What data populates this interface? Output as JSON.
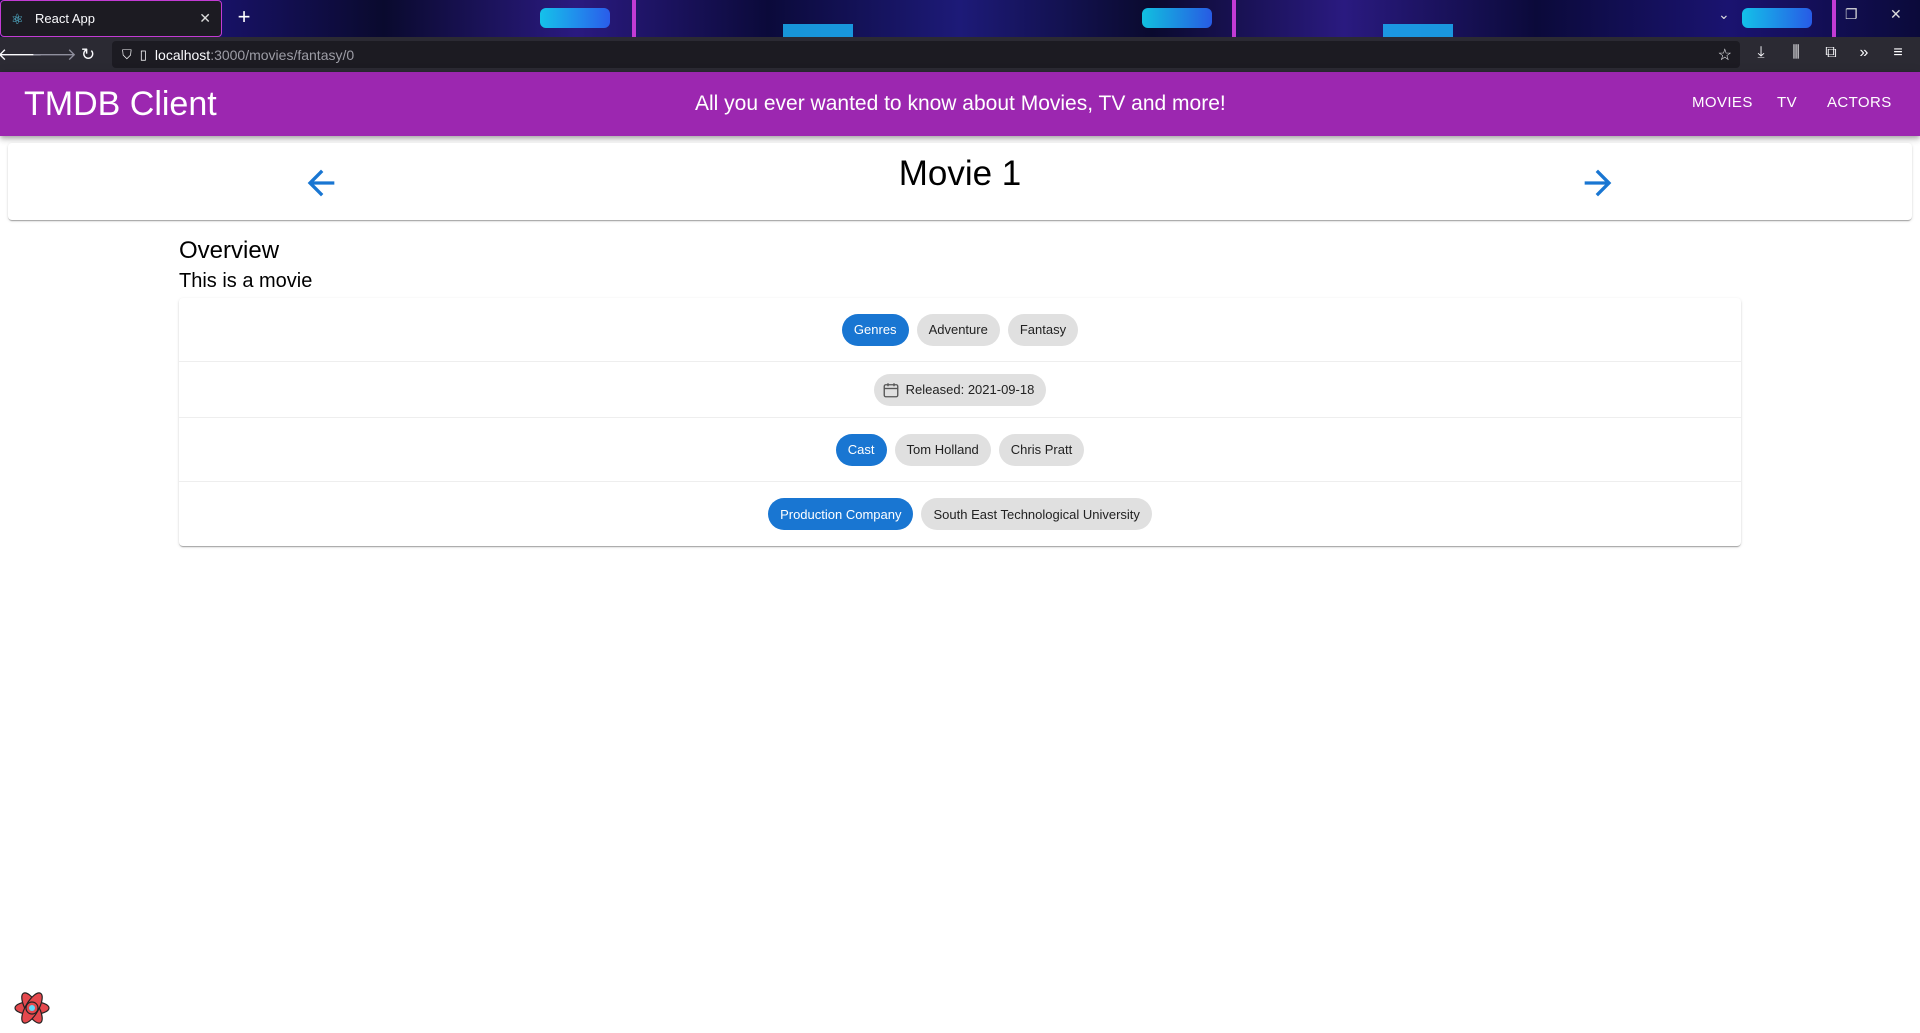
{
  "browser": {
    "tab_title": "React App",
    "url_host": "localhost",
    "url_path": ":3000/movies/fantasy/0"
  },
  "app": {
    "title": "TMDB Client",
    "tagline": "All you ever wanted to know about Movies, TV and more!",
    "nav": [
      "MOVIES",
      "TV",
      "ACTORS"
    ]
  },
  "movie": {
    "title": "Movie 1",
    "overview_heading": "Overview",
    "overview": "This is a movie",
    "genres_label": "Genres",
    "genres": [
      "Adventure",
      "Fantasy"
    ],
    "released": "Released: 2021-09-18",
    "cast_label": "Cast",
    "cast": [
      "Tom Holland",
      "Chris Pratt"
    ],
    "production_label": "Production Company",
    "production": [
      "South East Technological University"
    ]
  },
  "colors": {
    "appbar": "#9c27b0",
    "primary": "#1976d2",
    "chip": "#e0e0e0"
  }
}
